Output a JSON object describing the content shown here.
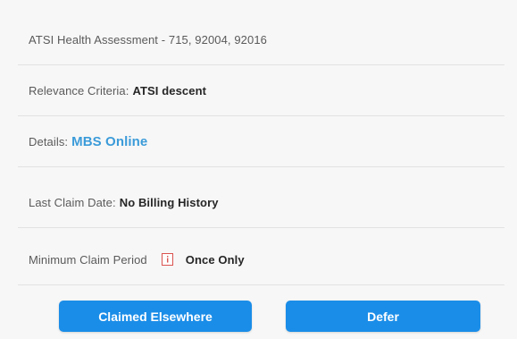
{
  "rows": {
    "assessment": {
      "text": "ATSI Health Assessment - 715, 92004, 92016"
    },
    "relevance": {
      "label": "Relevance Criteria:",
      "value": "ATSI descent"
    },
    "details": {
      "label": "Details:",
      "link": "MBS Online"
    },
    "last_claim": {
      "label": "Last Claim Date:",
      "value": "No Billing History"
    },
    "min_period": {
      "label": "Minimum Claim Period",
      "icon": "info-icon",
      "value": "Once Only"
    }
  },
  "buttons": {
    "claimed_elsewhere": "Claimed Elsewhere",
    "defer": "Defer"
  },
  "colors": {
    "button_bg": "#1a8de8",
    "link": "#3b9bd9",
    "icon_red": "#d9534f"
  }
}
